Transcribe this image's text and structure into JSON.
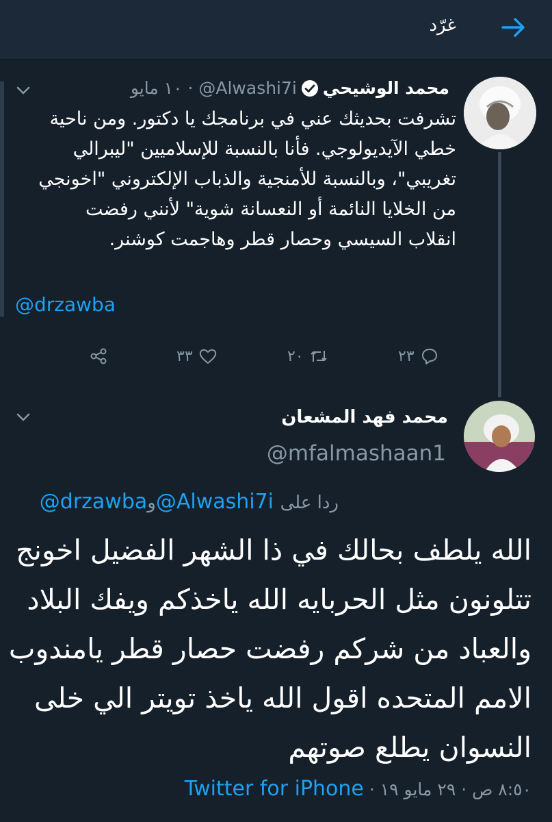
{
  "header": {
    "title": "غرّد"
  },
  "tweet1": {
    "display_name": "محمد الوشيحي",
    "handle": "@Alwashi7i",
    "date": "١٠ مايو",
    "body": "تشرفت بحديثك عني في برنامجك يا دكتور. ومن ناحية خطي الآيديولوجي. فأنا بالنسبة للإسلاميين \"ليبرالي تغريبي\"، وبالنسبة للأمنجية والذباب الإلكتروني \"اخونجي من الخلايا النائمة أو النعسانة شوية\" لأنني رفضت انقلاب السيسي وحصار قطر وهاجمت كوشنر.",
    "mention": "@drzawba",
    "replies_count": "٢٣",
    "retweets_count": "٢٠",
    "likes_count": "٣٣"
  },
  "tweet2": {
    "display_name": "محمد فهد المشعان",
    "handle": "@mfalmashaan1",
    "reply_label": "ردا على",
    "reply_mention_1": "@Alwashi7i",
    "reply_and": "و",
    "reply_mention_2": "@drzawba",
    "body": "الله يلطف بحالك في ذا الشهر الفضيل اخونج تتلونون مثل الحربايه الله ياخذكم ويفك البلاد والعباد من شركم رفضت حصار قطر يامندوب الامم المتحده اقول الله ياخذ تويتر الي خلى النسوان يطلع صوتهم",
    "time": "٨:٥٠ ص",
    "date": "٢٩ مايو ١٩",
    "source": "Twitter for iPhone"
  },
  "colors": {
    "background": "#15202b",
    "header": "#1c2938",
    "accent": "#1da1f2",
    "muted": "#8899a6"
  }
}
